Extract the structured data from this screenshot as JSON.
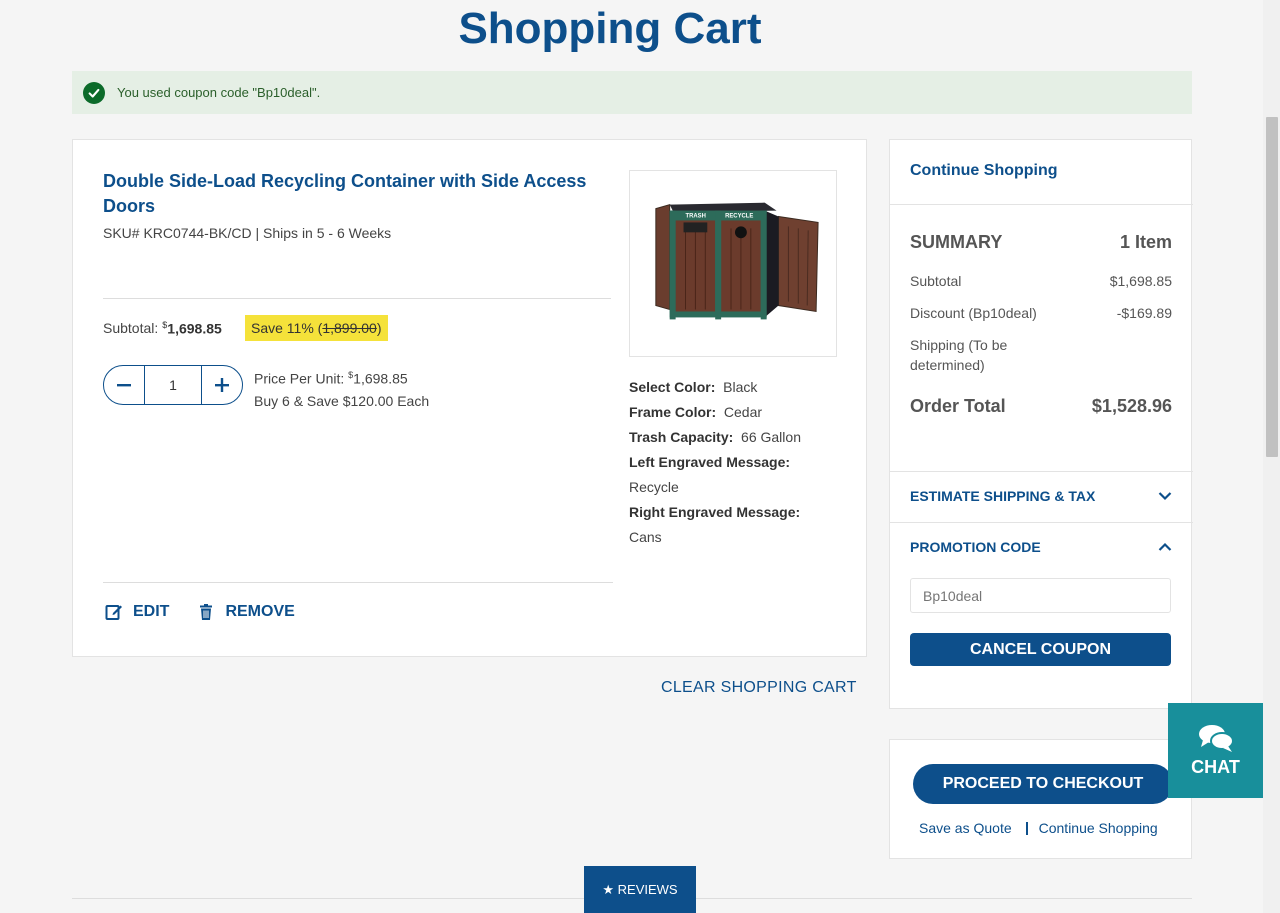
{
  "page": {
    "title": "Shopping Cart"
  },
  "alert": {
    "message": "You used coupon code \"Bp10deal\"."
  },
  "item": {
    "title": "Double Side-Load Recycling Container with Side Access Doors",
    "sku_line": "SKU# KRC0744-BK/CD | Ships in 5 - 6 Weeks",
    "subtotal_label": "Subtotal:",
    "subtotal_currency": "$",
    "subtotal_amount": "1,698.85",
    "save_text": "Save 11% (",
    "save_original": "1,899.00",
    "save_close": ")",
    "quantity": "1",
    "price_per_unit_label": "Price Per Unit:",
    "price_per_unit_currency": "$",
    "price_per_unit_amount": "1,698.85",
    "bulk_offer": "Buy 6 & Save $120.00 Each",
    "image_labels": {
      "left": "TRASH",
      "right": "RECYCLE"
    },
    "options": [
      {
        "label": "Select Color:",
        "value": "Black"
      },
      {
        "label": "Frame Color:",
        "value": "Cedar"
      },
      {
        "label": "Trash Capacity:",
        "value": "66 Gallon"
      },
      {
        "label": "Left Engraved Message:",
        "value": "Recycle"
      },
      {
        "label": "Right Engraved Message:",
        "value": "Cans"
      }
    ],
    "edit_label": "EDIT",
    "remove_label": "REMOVE"
  },
  "clear_cart_label": "CLEAR SHOPPING CART",
  "summary": {
    "continue_label": "Continue Shopping",
    "heading": "SUMMARY",
    "item_count": "1 Item",
    "subtotal_label": "Subtotal",
    "subtotal_value": "$1,698.85",
    "discount_label": "Discount (Bp10deal)",
    "discount_value": "-$169.89",
    "shipping_label": "Shipping (To be determined)",
    "order_total_label": "Order Total",
    "order_total_value": "$1,528.96",
    "estimate_label": "ESTIMATE SHIPPING & TAX",
    "promo_label": "PROMOTION CODE",
    "promo_placeholder": "Bp10deal",
    "cancel_coupon_label": "CANCEL COUPON"
  },
  "checkout": {
    "proceed_label": "PROCEED TO CHECKOUT",
    "save_quote_label": "Save as Quote",
    "continue_label": "Continue Shopping"
  },
  "chat_label": "CHAT",
  "reviews_label": "★ REVIEWS",
  "colors": {
    "brand_blue": "#0d4f8b",
    "chat_teal": "#188f9b",
    "save_yellow": "#f5e23a",
    "success_green": "#0c6b2a"
  }
}
